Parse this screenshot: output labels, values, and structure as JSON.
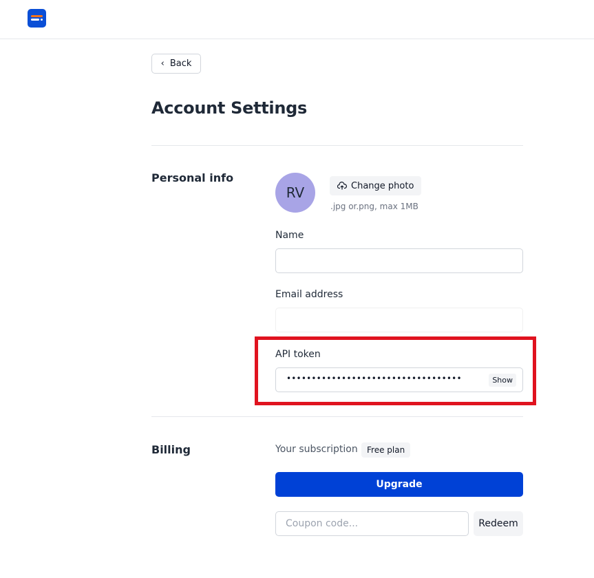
{
  "header": {
    "logo_icon": "app-logo-icon"
  },
  "nav": {
    "back_label": "Back",
    "back_icon": "chevron-left-icon"
  },
  "page": {
    "title": "Account Settings"
  },
  "personal_info": {
    "section_label": "Personal info",
    "avatar_initials": "RV",
    "avatar_color": "#a8a4e6",
    "change_photo_label": "Change photo",
    "change_photo_icon": "cloud-upload-icon",
    "photo_hint": ".jpg or.png, max 1MB",
    "name": {
      "label": "Name",
      "value": "",
      "placeholder": ""
    },
    "email": {
      "label": "Email address",
      "value": "",
      "placeholder": ""
    },
    "api_token": {
      "label": "API token",
      "masked_value": "•••••••••••••••••••••••••••••••••••",
      "show_label": "Show"
    }
  },
  "billing": {
    "section_label": "Billing",
    "subscription_label": "Your subscription",
    "plan_badge": "Free plan",
    "upgrade_label": "Upgrade",
    "coupon_placeholder": "Coupon code...",
    "redeem_label": "Redeem"
  },
  "colors": {
    "primary": "#0041d6",
    "highlight": "#e0131f",
    "logo_accent": "#f97316"
  }
}
